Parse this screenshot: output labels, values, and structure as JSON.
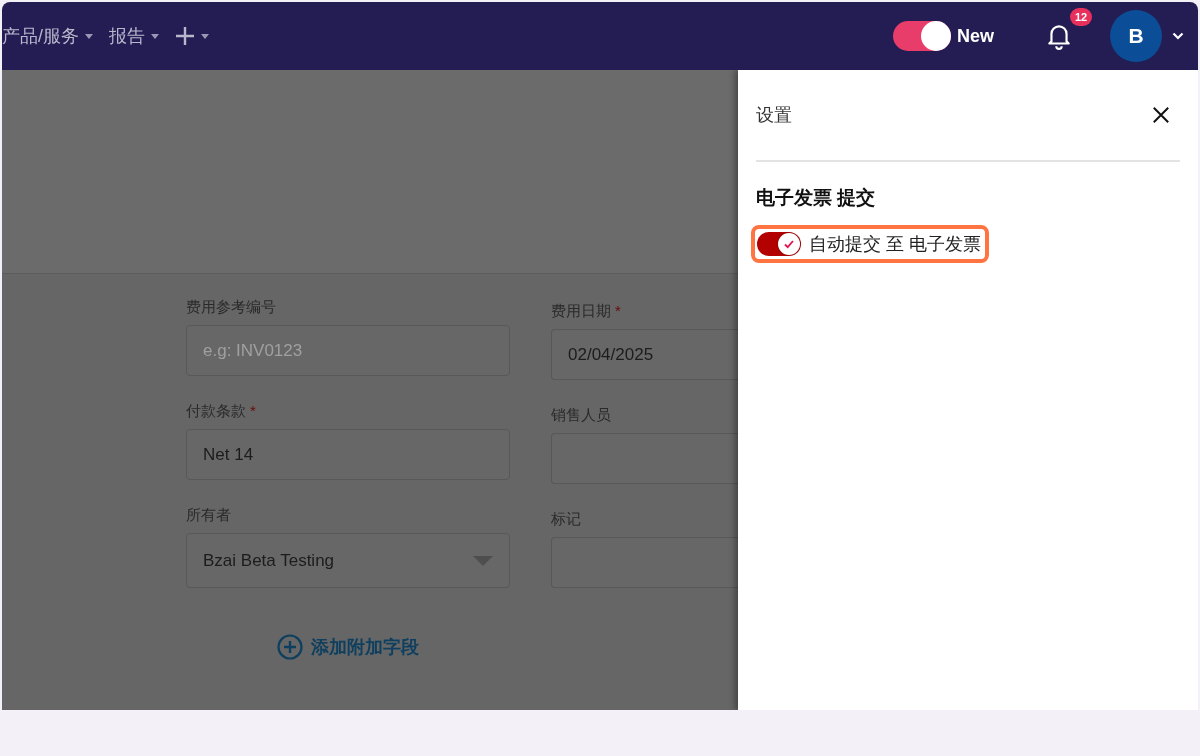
{
  "header": {
    "menus": [
      {
        "label": "产品/服务"
      },
      {
        "label": "报告"
      }
    ],
    "new_toggle": {
      "label": "New",
      "on": true
    },
    "notifications": {
      "count": "12"
    },
    "avatar": {
      "initial": "B"
    }
  },
  "form": {
    "fields": [
      {
        "label": "费用参考编号",
        "kind": "text",
        "placeholder": "e.g: INV0123"
      },
      {
        "label": "费用日期",
        "required_mark": "*",
        "kind": "text",
        "value": "02/04/2025"
      },
      {
        "label": "付款条款",
        "required_mark": "*",
        "kind": "text",
        "value": "Net 14"
      },
      {
        "label": "销售人员",
        "kind": "text"
      },
      {
        "label": "所有者",
        "kind": "select",
        "value": "Bzai Beta Testing"
      },
      {
        "label": "标记",
        "kind": "text"
      }
    ],
    "add_field_link": "添加附加字段"
  },
  "settings_panel": {
    "title": "设置",
    "section_title": "电子发票 提交",
    "toggles": [
      {
        "label": "自动提交 至 电子发票",
        "on": true,
        "highlighted": true
      }
    ]
  }
}
